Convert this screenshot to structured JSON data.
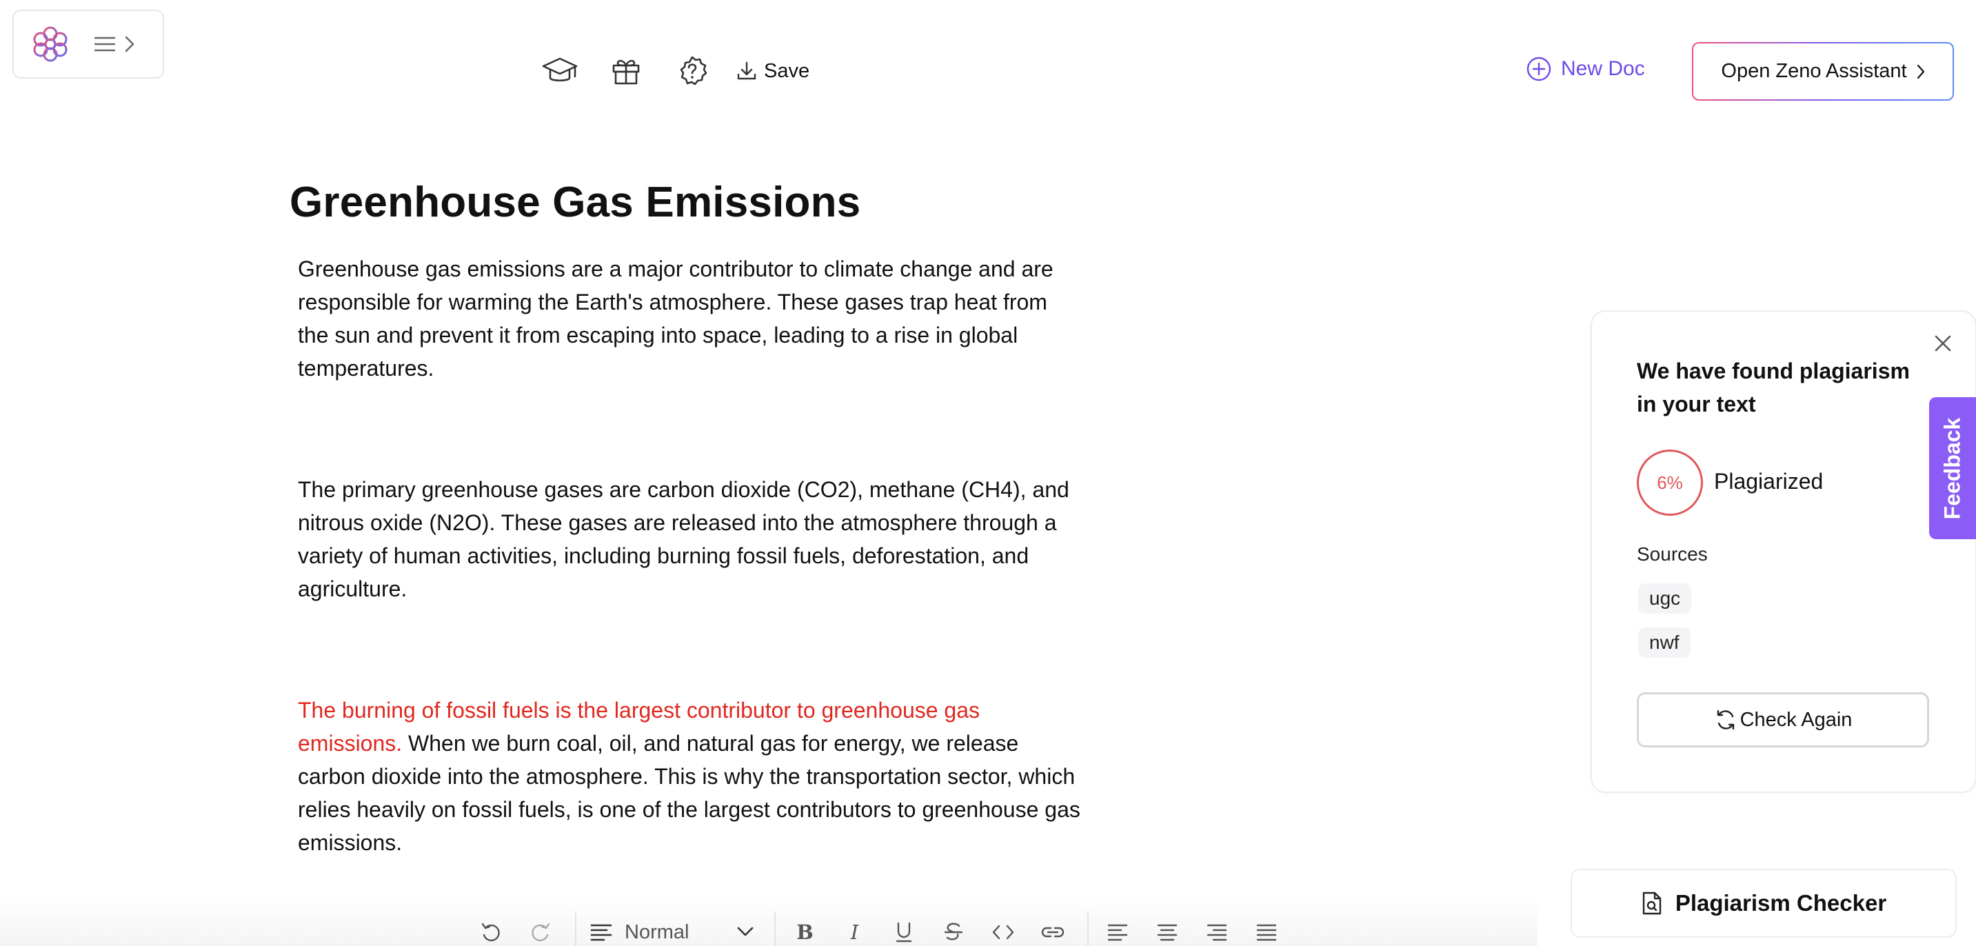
{
  "header": {
    "toolbar": {
      "icons": [
        "graduation-cap-icon",
        "gift-icon",
        "help-badge-icon",
        "download-icon"
      ],
      "save_label": "Save"
    },
    "new_doc_label": "New Doc",
    "open_assistant_label": "Open Zeno Assistant"
  },
  "document": {
    "title": "Greenhouse Gas Emissions",
    "paragraphs": [
      "Greenhouse gas emissions are a major contributor to climate change and are responsible for warming the Earth's atmosphere. These gases trap heat from the sun and prevent it from escaping into space, leading to a rise in global temperatures.",
      "The primary greenhouse gases are carbon dioxide (CO2), methane (CH4), and nitrous oxide (N2O). These gases are released into the atmosphere through a variety of human activities, including burning fossil fuels, deforestation, and agriculture."
    ],
    "paragraph3": {
      "highlighted": "The burning of fossil fuels is the largest contributor to greenhouse gas emissions.",
      "rest": " When we burn coal, oil, and natural gas for energy, we release carbon dioxide into the atmosphere. This is why the transportation sector, which relies heavily on fossil fuels, is one of the largest contributors to greenhouse gas emissions."
    }
  },
  "plagiarism_panel": {
    "heading": "We have found plagiarism in your text",
    "score": "6%",
    "score_label": "Plagiarized",
    "sources_title": "Sources",
    "sources": [
      "ugc",
      "nwf"
    ],
    "check_again_label": "Check Again"
  },
  "feedback_label": "Feedback",
  "plagiarism_checker_label": "Plagiarism Checker",
  "format_bar": {
    "style_value": "Normal",
    "bold_glyph": "B",
    "italic_glyph": "I"
  },
  "colors": {
    "accent": "#6d4ae8",
    "feedback_bg": "#8b5cf6",
    "highlight": "#e0281f",
    "score": "#e0575b"
  }
}
